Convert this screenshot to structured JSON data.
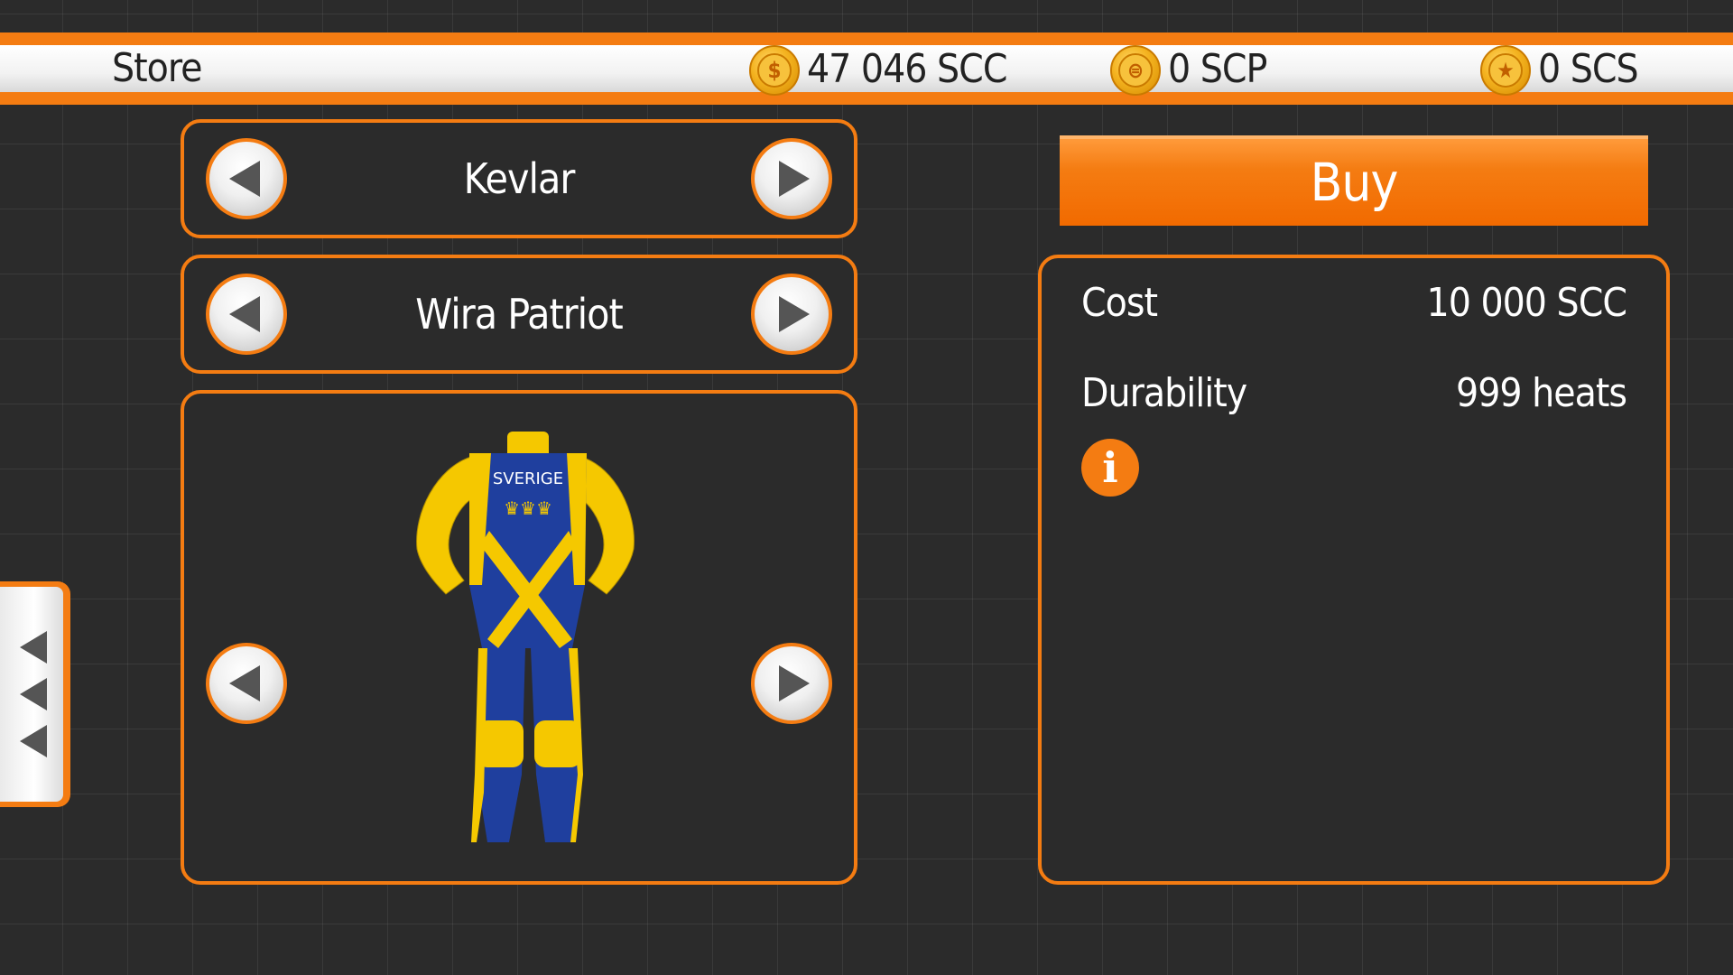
{
  "header": {
    "title": "Store",
    "currencies": [
      {
        "icon": "coin-dollar-icon",
        "symbol": "$",
        "text": "47 046 SCC"
      },
      {
        "icon": "coin-scp-icon",
        "symbol": "⊜",
        "text": "0 SCP"
      },
      {
        "icon": "coin-star-icon",
        "symbol": "★",
        "text": "0 SCS"
      }
    ]
  },
  "selectors": {
    "material": "Kevlar",
    "suit_name": "Wira Patriot"
  },
  "preview": {
    "suit_text": "SVERIGE",
    "colors": {
      "blue": "#1f3f9e",
      "yellow": "#f5c800"
    }
  },
  "details": {
    "buy_label": "Buy",
    "cost_label": "Cost",
    "cost_value": "10 000 SCC",
    "durability_label": "Durability",
    "durability_value": "999 heats",
    "info_symbol": "i"
  },
  "theme": {
    "accent": "#f47c12",
    "background": "#2b2b2b"
  }
}
